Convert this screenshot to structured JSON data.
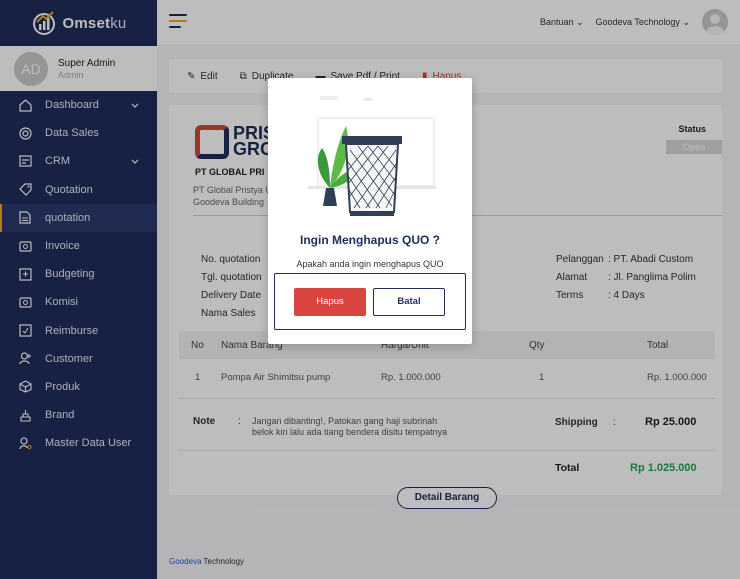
{
  "app": {
    "brand": "Omset",
    "brand_suffix": "ku"
  },
  "profile": {
    "initials": "AD",
    "name": "Super Admin",
    "role": "Admin"
  },
  "sidebar": {
    "items": [
      {
        "label": "Dashboard",
        "icon": "home-icon"
      },
      {
        "label": "Data Sales",
        "icon": "target-icon"
      },
      {
        "label": "CRM",
        "icon": "crm-icon"
      },
      {
        "label": "Quotation",
        "icon": "tag-icon"
      },
      {
        "label": "quotation",
        "icon": "document-icon"
      },
      {
        "label": "Invoice",
        "icon": "invoice-icon"
      },
      {
        "label": "Budgeting",
        "icon": "budget-icon"
      },
      {
        "label": "Komisi",
        "icon": "money-icon"
      },
      {
        "label": "Reimburse",
        "icon": "reimburse-icon"
      },
      {
        "label": "Customer",
        "icon": "customer-icon"
      },
      {
        "label": "Produk",
        "icon": "box-icon"
      },
      {
        "label": "Brand",
        "icon": "brand-icon"
      },
      {
        "label": "Master Data User",
        "icon": "user-gear-icon"
      }
    ]
  },
  "topbar": {
    "help": "Bantuan",
    "company": "Goodeva Technology"
  },
  "toolbar": {
    "edit": "Edit",
    "duplicate": "Duplicate",
    "save_pdf": "Save Pdf / Print",
    "delete": "Hapus"
  },
  "quotation": {
    "logo_text": "PRIS GRO",
    "logo_sub": "PT GLOBAL",
    "company_name": "PT GLOBAL PRI",
    "address_1": "PT Global Pristya U",
    "address_2": "Goodeva Building",
    "status_label": "Status",
    "status_sub": "QUO",
    "status_value": "Open",
    "no_label": "No. quotation",
    "date_label": "Tgl. quotation",
    "delivery_label": "Delivery Date",
    "sales_label": "Nama Sales",
    "customer_label": "Pelanggan",
    "customer_value": ": PT. Abadi Custom",
    "address_label": "Alamat",
    "address_value": ": Jl. Panglima Polim",
    "terms_label": "Terms",
    "terms_value": ": 4 Days"
  },
  "table": {
    "headers": {
      "no": "No",
      "name": "Nama Barang",
      "price": "Harga/Unit",
      "qty": "Qty",
      "total": "Total"
    },
    "rows": [
      {
        "no": "1",
        "name": "Pompa Air Shimitsu pump",
        "price": "Rp. 1.000.000",
        "qty": "1",
        "total": "Rp. 1.000.000"
      }
    ]
  },
  "summary": {
    "note_label": "Note",
    "note_colon": ":",
    "note_line_1": "Jangan dibanting!, Patokan gang haji subrinah",
    "note_line_2": "belok kiri lalu ada tiang bendera disitu tempatnya",
    "shipping_label": "Shipping",
    "shipping_colon": ":",
    "shipping_value": "Rp 25.000",
    "total_label": "Total",
    "total_value": "Rp 1.025.000"
  },
  "detail_button": "Detail Barang",
  "footer": {
    "brand": "Goodeva",
    "rest": " Technology"
  },
  "modal": {
    "title": "Ingin Menghapus QUO ?",
    "message": "Apakah anda ingin menghapus QUO",
    "confirm": "Hapus",
    "cancel": "Batal"
  },
  "colors": {
    "sidebar": "#1e2d5c",
    "accent": "#f5a623",
    "danger": "#d9443f",
    "success": "#27a35a"
  }
}
